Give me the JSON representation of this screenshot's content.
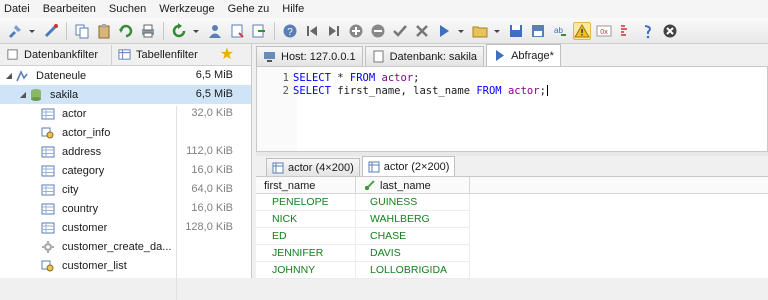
{
  "menu": [
    "Datei",
    "Bearbeiten",
    "Suchen",
    "Werkzeuge",
    "Gehe zu",
    "Hilfe"
  ],
  "left_panel": {
    "filter_tab": "Datenbankfilter",
    "table_filter_tab": "Tabellenfilter",
    "session": {
      "name": "Dateneule",
      "size": "6,5 MiB"
    },
    "database": {
      "name": "sakila",
      "size": "6,5 MiB"
    },
    "objects": [
      {
        "name": "actor",
        "size": "32,0 KiB",
        "icon": "table-icon"
      },
      {
        "name": "actor_info",
        "size": "",
        "icon": "view-icon"
      },
      {
        "name": "address",
        "size": "112,0 KiB",
        "icon": "table-icon"
      },
      {
        "name": "category",
        "size": "16,0 KiB",
        "icon": "table-icon"
      },
      {
        "name": "city",
        "size": "64,0 KiB",
        "icon": "table-icon"
      },
      {
        "name": "country",
        "size": "16,0 KiB",
        "icon": "table-icon"
      },
      {
        "name": "customer",
        "size": "128,0 KiB",
        "icon": "table-icon"
      },
      {
        "name": "customer_create_da...",
        "size": "",
        "icon": "procedure-icon"
      },
      {
        "name": "customer_list",
        "size": "",
        "icon": "view-icon"
      }
    ]
  },
  "tabs": [
    {
      "label": "Host: 127.0.0.1",
      "active": false
    },
    {
      "label": "Datenbank: sakila",
      "active": false
    },
    {
      "label": "Abfrage*",
      "active": true
    }
  ],
  "editor": {
    "lines": [
      {
        "no": "1",
        "kw1": "SELECT",
        "mid": " * ",
        "kw2": "FROM",
        "table": "actor",
        "end": ";"
      },
      {
        "no": "2",
        "kw1": "SELECT",
        "mid": " first_name, last_name ",
        "kw2": "FROM",
        "table": "actor",
        "end": ";"
      }
    ]
  },
  "result_tabs": [
    {
      "label": "actor (4×200)",
      "active": false
    },
    {
      "label": "actor (2×200)",
      "active": true
    }
  ],
  "grid": {
    "columns": [
      "first_name",
      "last_name"
    ],
    "rows": [
      [
        "PENELOPE",
        "GUINESS"
      ],
      [
        "NICK",
        "WAHLBERG"
      ],
      [
        "ED",
        "CHASE"
      ],
      [
        "JENNIFER",
        "DAVIS"
      ],
      [
        "JOHNNY",
        "LOLLOBRIGIDA"
      ]
    ]
  },
  "colors": {
    "value_text": "#14801b",
    "keyword": "#0000ff",
    "identifier": "#8b008b",
    "selection": "#cfe4f7"
  }
}
